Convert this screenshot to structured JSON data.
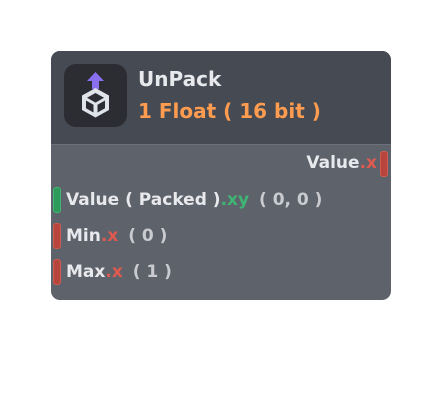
{
  "node": {
    "title": "UnPack",
    "subtitle": "1 Float ( 16 bit )",
    "icon": "unpack-box-icon",
    "output": {
      "label": "Value",
      "swizzle": ".x"
    },
    "inputs": [
      {
        "label": "Value ( Packed )",
        "swizzle": ".xy",
        "value": "( 0, 0 )"
      },
      {
        "label": "Min",
        "swizzle": ".x",
        "value": "( 0 )"
      },
      {
        "label": "Max",
        "swizzle": ".x",
        "value": "( 1 )"
      }
    ]
  },
  "colors": {
    "header_bg": "#464a53",
    "body_bg": "#5e626b",
    "subtitle": "#ff9c4f",
    "float_port": "#b8453d",
    "vector2_port": "#2e9a5c",
    "icon_arrow": "#8a6ff0"
  }
}
